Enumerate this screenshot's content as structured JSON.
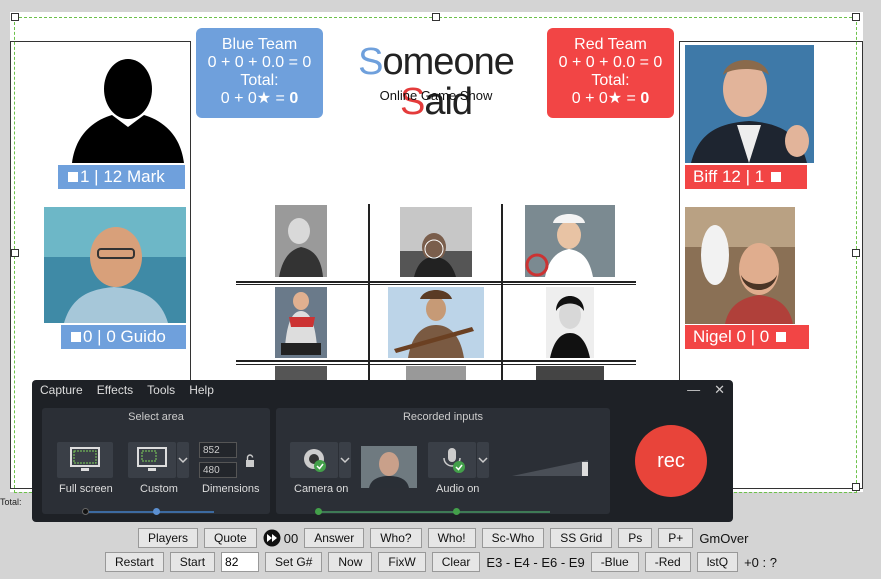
{
  "blue_team": {
    "title": "Blue Team",
    "score_line": "0 + 0 + 0.0 = 0",
    "total_label": "Total:",
    "total_expr": "0 + 0★ = ",
    "total_value": "0"
  },
  "red_team": {
    "title": "Red Team",
    "score_line": "0 + 0 + 0.0 = 0",
    "total_label": "Total:",
    "total_expr": "0 + 0★ = ",
    "total_value": "0"
  },
  "logo": {
    "first_letter": "S",
    "part1": "omeone ",
    "second_letter": "S",
    "part2": "aid",
    "tagline": "Online Game Show"
  },
  "players": {
    "mark": {
      "label": "1 | 12  Mark"
    },
    "guido": {
      "label": "0 | 0  Guido"
    },
    "biff": {
      "label": "Biff 12 | 1"
    },
    "nigel": {
      "label": "Nigel 0 | 0"
    }
  },
  "recorder": {
    "menu": [
      "Capture",
      "Effects",
      "Tools",
      "Help"
    ],
    "window_buttons": [
      "—",
      "✕"
    ],
    "select_area": {
      "title": "Select area",
      "full_screen": "Full screen",
      "custom": "Custom",
      "dimensions": "Dimensions",
      "width": "852",
      "height": "480"
    },
    "recorded_inputs": {
      "title": "Recorded inputs",
      "camera": "Camera on",
      "audio": "Audio on"
    },
    "rec_label": "rec"
  },
  "toolbar1": {
    "players": "Players",
    "quote": "Quote",
    "counter": "00",
    "answer": "Answer",
    "who_q": "Who?",
    "who_x": "Who!",
    "sc_who": "Sc-Who",
    "ss_grid": "SS Grid",
    "ps": "Ps",
    "p_plus": "P+",
    "gmover": "GmOver"
  },
  "toolbar2": {
    "restart": "Restart",
    "start": "Start",
    "game_num": "82",
    "set_g": "Set G#",
    "now": "Now",
    "fixw": "FixW",
    "clear": "Clear",
    "episodes": "E3 - E4 - E6 - E9",
    "minus_blue": "-Blue",
    "minus_red": "-Red",
    "lstq": "lstQ",
    "tally": "+0 : ?"
  },
  "total_small": "Total:",
  "colors": {
    "blue": "#6fa0dc",
    "red": "#f24545",
    "rec": "#e8443a",
    "panel": "#1e2126"
  }
}
